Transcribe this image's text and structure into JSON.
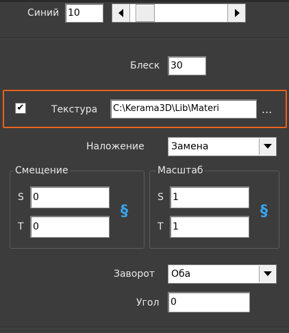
{
  "blue": {
    "label": "Синий",
    "value": "10",
    "slider_fraction": 0.06
  },
  "gloss": {
    "label": "Блеск",
    "value": "30"
  },
  "texture": {
    "label": "Текстура",
    "path": "C:\\Kerama3D\\Lib\\Materi",
    "browse": "..."
  },
  "overlay": {
    "label": "Наложение",
    "selected": "Замена"
  },
  "offset": {
    "title": "Смещение",
    "s_label": "S",
    "s_value": "0",
    "t_label": "T",
    "t_value": "0"
  },
  "scale": {
    "title": "Масштаб",
    "s_label": "S",
    "s_value": "1",
    "t_label": "T",
    "t_value": "1"
  },
  "wrap": {
    "label": "Заворот",
    "selected": "Оба"
  },
  "angle": {
    "label": "Угол",
    "value": "0"
  },
  "icons": {
    "link": "§",
    "check": "✔"
  },
  "colors": {
    "highlight": "#e8631f",
    "link": "#37a4f0",
    "background": "#3c3c3c"
  }
}
